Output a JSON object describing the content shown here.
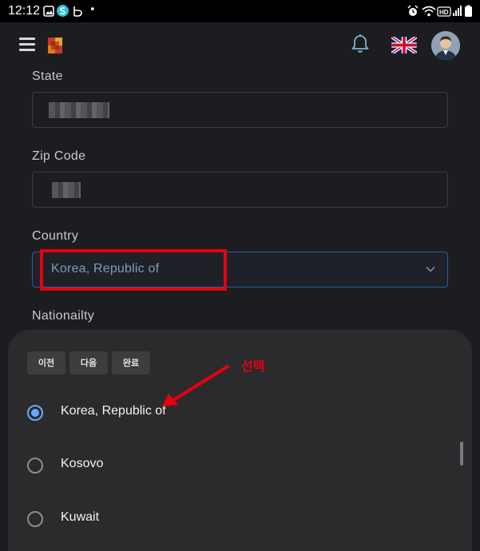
{
  "status_bar": {
    "time": "12:12",
    "dot": "•",
    "left_icons": [
      "gallery-icon",
      "s-app-icon",
      "b-app-icon"
    ],
    "right_icons": [
      "alarm-icon",
      "wifi-icon",
      "hd-icon",
      "signal-icon",
      "battery-icon"
    ]
  },
  "header": {
    "menu_icon": "hamburger-icon",
    "notification_icon": "bell-icon",
    "language_flag": "uk-flag-icon",
    "avatar": "user-avatar"
  },
  "form": {
    "state_label": "State",
    "zip_label": "Zip Code",
    "country_label": "Country",
    "country_value": "Korea, Republic of",
    "nationality_label": "Nationailty"
  },
  "picker": {
    "buttons": {
      "prev": "이전",
      "next": "다음",
      "done": "완료"
    },
    "options": [
      {
        "label": "Korea, Republic of",
        "selected": true
      },
      {
        "label": "Kosovo",
        "selected": false
      },
      {
        "label": "Kuwait",
        "selected": false
      }
    ]
  },
  "annotation": {
    "text": "선택",
    "color": "#e8000c"
  },
  "colors": {
    "background": "#1c1d21",
    "sheet": "#2b2b2d",
    "accent_blue": "#6aa8ff",
    "select_border": "#2e5aa8",
    "select_text": "#8399b3"
  }
}
